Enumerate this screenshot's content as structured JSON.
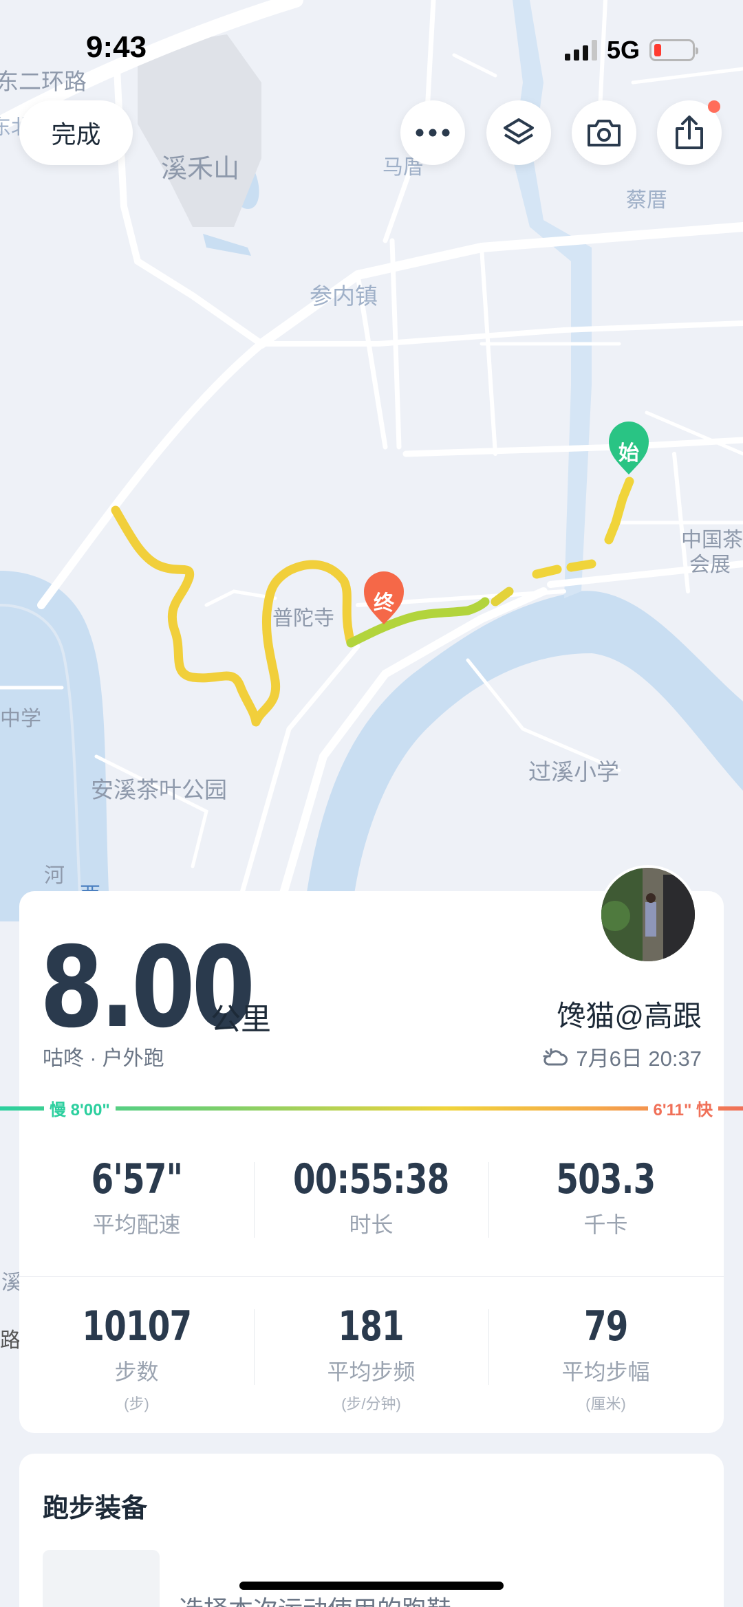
{
  "status_bar": {
    "time": "9:43",
    "network": "5G"
  },
  "map": {
    "labels": [
      "东二环路",
      "东北",
      "溪禾山",
      "马厝",
      "蔡厝",
      "参内镇",
      "中国茶",
      "会展",
      "普陀寺",
      "中学",
      "安溪茶叶公园",
      "过溪小学",
      "河",
      "西",
      "溪",
      "路"
    ],
    "start_marker": "始",
    "end_marker": "终"
  },
  "toolbar": {
    "done_label": "完成",
    "icons": [
      "more-icon",
      "layers-icon",
      "camera-icon",
      "share-icon"
    ]
  },
  "summary": {
    "distance": "8.00",
    "unit": "公里",
    "subtitle": "咕咚 · 户外跑",
    "username": "馋猫@高跟",
    "date": "7月6日 20:37"
  },
  "pace_scale": {
    "slow": "慢 8'00\"",
    "fast": "6'11\" 快"
  },
  "metrics_row1": [
    {
      "value": "6'57\"",
      "label": "平均配速"
    },
    {
      "value": "00:55:38",
      "label": "时长"
    },
    {
      "value": "503.3",
      "label": "千卡"
    }
  ],
  "metrics_row2": [
    {
      "value": "10107",
      "label": "步数",
      "unit": "(步)"
    },
    {
      "value": "181",
      "label": "平均步频",
      "unit": "(步/分钟)"
    },
    {
      "value": "79",
      "label": "平均步幅",
      "unit": "(厘米)"
    }
  ],
  "gear": {
    "title": "跑步装备",
    "prompt": "选择本次运动使用的跑鞋"
  }
}
